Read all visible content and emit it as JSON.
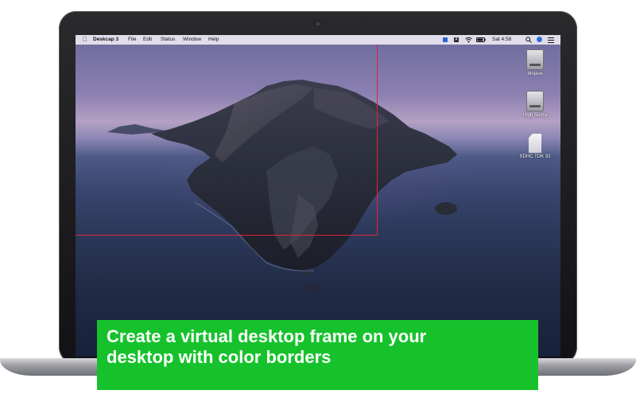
{
  "menubar": {
    "app_name": "Deskcap 3",
    "items": [
      "File",
      "Edit",
      "Status",
      "Window",
      "Help"
    ],
    "clock": "Sat 4:58"
  },
  "desktop_icons": [
    {
      "label": "Mojave",
      "icon": "hard-drive-icon"
    },
    {
      "label": "High Sierra",
      "icon": "hard-drive-icon"
    },
    {
      "label": "SDHC TDK 32",
      "icon": "sd-card-icon"
    }
  ],
  "caption": {
    "line1": "Create a virtual desktop frame on your",
    "line2": "desktop with color borders"
  },
  "colors": {
    "frame_border": "#e0213a",
    "caption_background": "#16c22c",
    "caption_text": "#ffffff"
  }
}
